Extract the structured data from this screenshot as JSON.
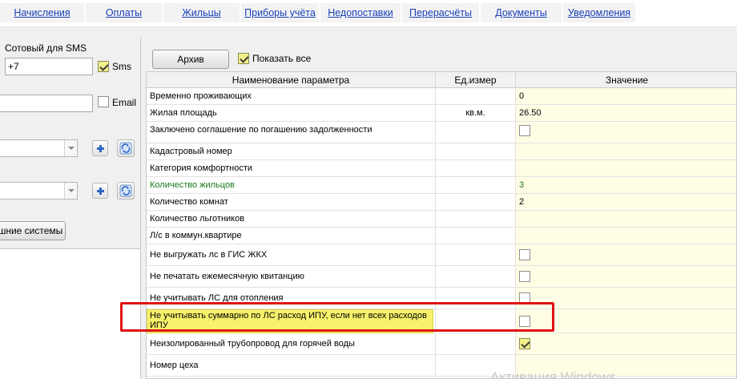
{
  "nav": {
    "tabs": [
      {
        "label": "Начисления"
      },
      {
        "label": "Оплаты"
      },
      {
        "label": "Жильцы"
      },
      {
        "label": "Приборы учёта"
      },
      {
        "label": "Недопоставки"
      },
      {
        "label": "Перерасчёты"
      },
      {
        "label": "Документы"
      },
      {
        "label": "Уведомления"
      }
    ]
  },
  "left": {
    "sms_label": "Сотовый для SMS",
    "phone_value": "+7",
    "sms_checkbox_label": "Sms",
    "email_value": "",
    "email_checkbox_label": "Email",
    "systems_button": "шние системы"
  },
  "toolbar": {
    "archive_button": "Архив",
    "show_all_label": "Показать все"
  },
  "grid": {
    "headers": {
      "name": "Наименование параметра",
      "unit": "Ед.измер",
      "value": "Значение"
    },
    "rows": [
      {
        "name": "Временно проживающих",
        "unit": "",
        "value": "0"
      },
      {
        "name": "Жилая площадь",
        "unit": "кв.м.",
        "value": "26.50"
      },
      {
        "name": "Заключено соглашение по погашению задолженности",
        "unit": "",
        "value": ""
      },
      {
        "name": "Кадастровый номер",
        "unit": "",
        "value": ""
      },
      {
        "name": "Категория комфортности",
        "unit": "",
        "value": ""
      },
      {
        "name": "Количество жильцов",
        "unit": "",
        "value": "3"
      },
      {
        "name": "Количество комнат",
        "unit": "",
        "value": "2"
      },
      {
        "name": "Количество льготников",
        "unit": "",
        "value": ""
      },
      {
        "name": "Л/с в коммун.квартире",
        "unit": "",
        "value": ""
      },
      {
        "name": "Не выгружать лс в ГИС ЖКХ",
        "unit": "",
        "value": ""
      },
      {
        "name": "Не печатать ежемесячную квитанцию",
        "unit": "",
        "value": ""
      },
      {
        "name": "Не учитывать ЛС для отопления",
        "unit": "",
        "value": ""
      },
      {
        "name": "Не учитывать суммарно по ЛС расход ИПУ, если нет всех расходов ИПУ",
        "unit": "",
        "value": ""
      },
      {
        "name": "Неизолированный трубопровод для горячей воды",
        "unit": "",
        "value": ""
      },
      {
        "name": "Номер цеха",
        "unit": "",
        "value": ""
      }
    ]
  },
  "colors": {
    "accent_red": "#e01212",
    "link_blue": "#1a3fb5",
    "highlight_yellow": "#f7f16b"
  },
  "watermark": "Активация Windows"
}
